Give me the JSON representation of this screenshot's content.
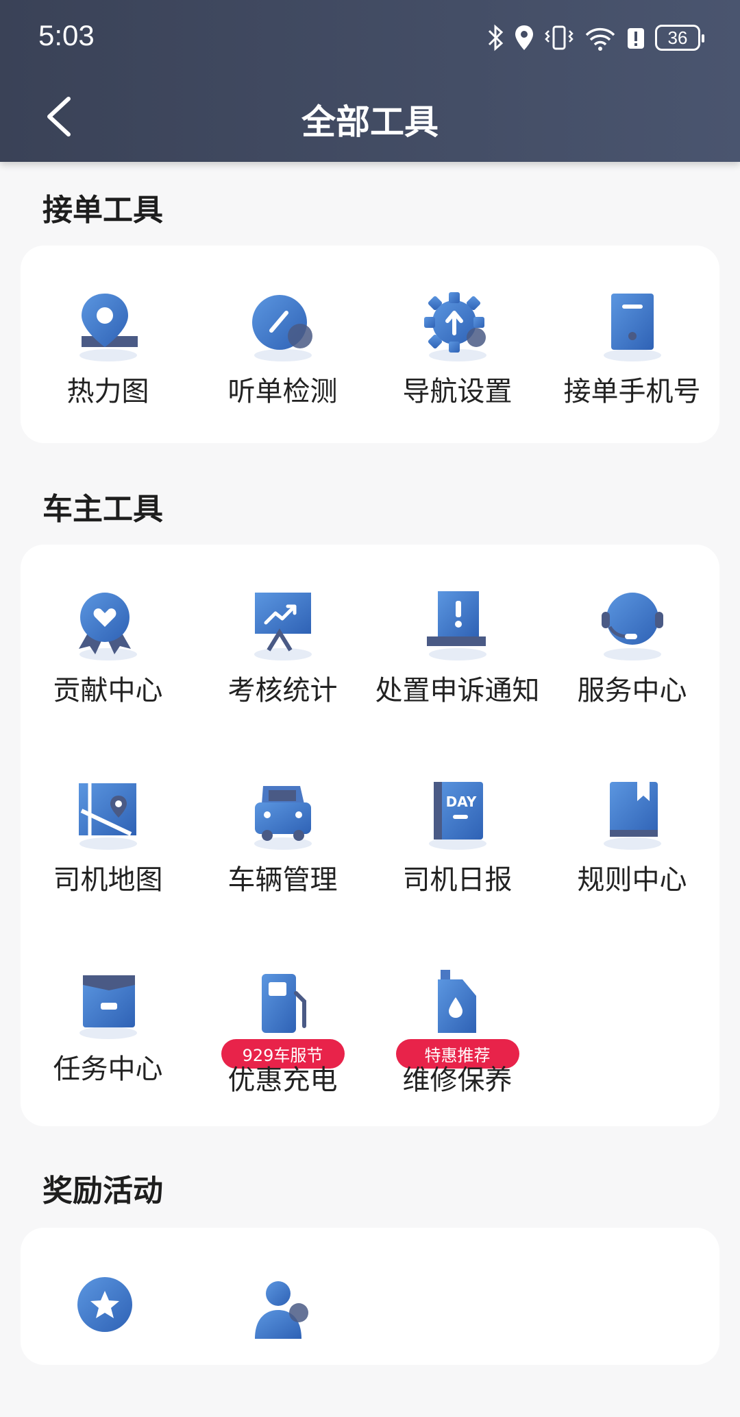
{
  "status_bar": {
    "time": "5:03",
    "battery": "36"
  },
  "header": {
    "title": "全部工具"
  },
  "sections": [
    {
      "title": "接单工具",
      "items": [
        {
          "label": "热力图",
          "icon": "map-pin-icon"
        },
        {
          "label": "听单检测",
          "icon": "gauge-icon"
        },
        {
          "label": "导航设置",
          "icon": "gear-arrow-icon"
        },
        {
          "label": "接单手机号",
          "icon": "phone-icon"
        }
      ]
    },
    {
      "title": "车主工具",
      "items": [
        {
          "label": "贡献中心",
          "icon": "heart-badge-icon"
        },
        {
          "label": "考核统计",
          "icon": "chart-board-icon"
        },
        {
          "label": "处置申诉通知",
          "icon": "alert-laptop-icon"
        },
        {
          "label": "服务中心",
          "icon": "headset-icon"
        },
        {
          "label": "司机地图",
          "icon": "map-icon"
        },
        {
          "label": "车辆管理",
          "icon": "car-icon"
        },
        {
          "label": "司机日报",
          "icon": "day-book-icon"
        },
        {
          "label": "规则中心",
          "icon": "bookmark-book-icon"
        },
        {
          "label": "任务中心",
          "icon": "task-box-icon"
        },
        {
          "label": "优惠充电",
          "icon": "fuel-pump-icon",
          "badge": "929车服节"
        },
        {
          "label": "维修保养",
          "icon": "oil-can-icon",
          "badge": "特惠推荐"
        }
      ]
    },
    {
      "title": "奖励活动",
      "items": [
        {
          "label": "",
          "icon": "star-badge-icon"
        },
        {
          "label": "",
          "icon": "person-icon"
        }
      ]
    }
  ],
  "colors": {
    "accent": "#3d76c7",
    "badge": "#e8234a",
    "header_start": "#3a4257",
    "header_end": "#4a556f"
  }
}
